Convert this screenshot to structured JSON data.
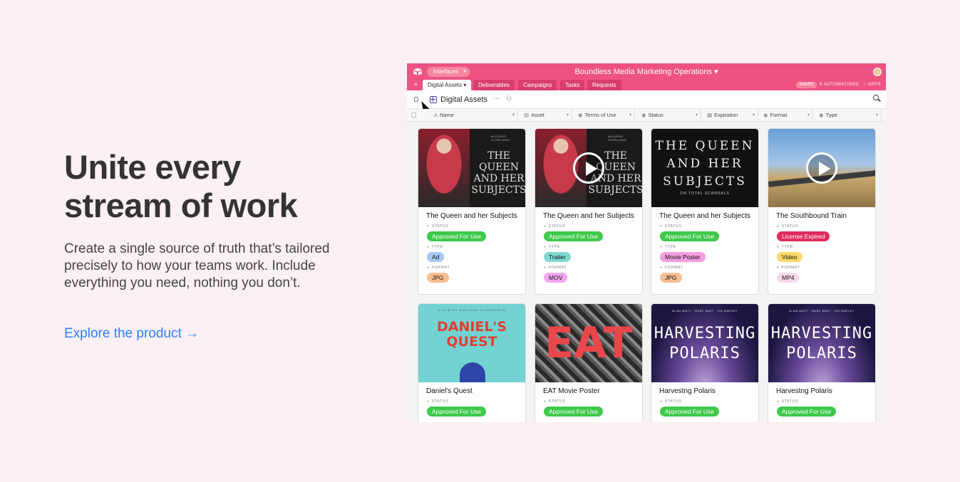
{
  "hero": {
    "headline_line1": "Unite every",
    "headline_line2": "stream of work",
    "body": "Create a single source of truth that’s tailored precisely to how your teams work. Include everything you need, nothing you don’t.",
    "cta": "Explore the product →"
  },
  "app": {
    "interfaces_label": "Interfaces",
    "base_title": "Boundless Media Marketing Operations ▾",
    "tabs": [
      "Digital Assets ▾",
      "Deliverables",
      "Campaigns",
      "Tasks",
      "Requests"
    ],
    "share_label": "SHARE",
    "automations_label": "AUTOMATIONS",
    "apps_label": "APPS",
    "view_title": "Digital Assets",
    "view_more": "···",
    "fields": [
      "Name",
      "Asset",
      "Terms of Use",
      "Status",
      "Expiration",
      "Format",
      "Type"
    ],
    "labels": {
      "status": "STATUS",
      "type": "TYPE",
      "format": "FORMAT"
    },
    "cards": [
      {
        "title": "The Queen and her Subjects",
        "status": "Approved For Use",
        "type": "Ad",
        "format": "JPG",
        "thumb": {
          "small": "MILDRED COPELAND",
          "title": "THE QUEEN AND HER SUBJECTS"
        }
      },
      {
        "title": "The Queen and her Subjects",
        "status": "Approved For Use",
        "type": "Trailer",
        "format": "MOV",
        "thumb": {
          "small": "MILDRED COPELAND",
          "title": "THE QUEEN AND HER SUBJECTS"
        }
      },
      {
        "title": "The Queen and her Subjects",
        "status": "Approved For Use",
        "type": "Movie Poster",
        "format": "JPG",
        "thumb": {
          "title": "THE QUEEN AND HER SUBJECTS",
          "sub": "ON TOTAL SCANDALS"
        }
      },
      {
        "title": "The Southbound Train",
        "status": "License Expired",
        "type": "Video",
        "format": "MP4"
      },
      {
        "title": "Daniel's Quest",
        "status": "Approved For Use",
        "thumb": {
          "small": "A FILM BY SHELDON SILVERSTEIN",
          "title": "DANIEL'S QUEST"
        }
      },
      {
        "title": "EAT Movie Poster",
        "status": "Approved For Use",
        "thumb": {
          "title": "EAT"
        }
      },
      {
        "title": "Harvestng Polaris",
        "status": "Approved For Use",
        "thumb": {
          "small": "ALAN WATT · RUBY WAIT · JIN HARVEY",
          "title": "HARVESTING POLARIS"
        }
      },
      {
        "title": "Harvestng Polaris",
        "status": "Approved For Use",
        "thumb": {
          "small": "ALAN WATT · RUBY WAIT · JIN HARVEY",
          "title": "HARVESTING POLARIS"
        }
      }
    ]
  },
  "colors": {
    "page_bg": "#fbf0f3",
    "brand_pink": "#ee5283",
    "cta_blue": "#2d7ff9",
    "status_approved": "#3ec94a",
    "status_expired": "#e02c5c",
    "type_ad": "#a7c8f5",
    "type_trailer": "#7fd9d2",
    "type_movie_poster": "#f29ee0",
    "type_video": "#fbd96a",
    "format_jpg": "#f8be90",
    "format_mov": "#f3a6f0",
    "format_mp4": "#f6d8ea"
  },
  "icons": [
    "airtable-logo-icon",
    "menu-icon",
    "sidebar-toggle-icon",
    "cursor-icon",
    "grid-view-icon",
    "people-icon",
    "search-icon",
    "play-icon"
  ]
}
